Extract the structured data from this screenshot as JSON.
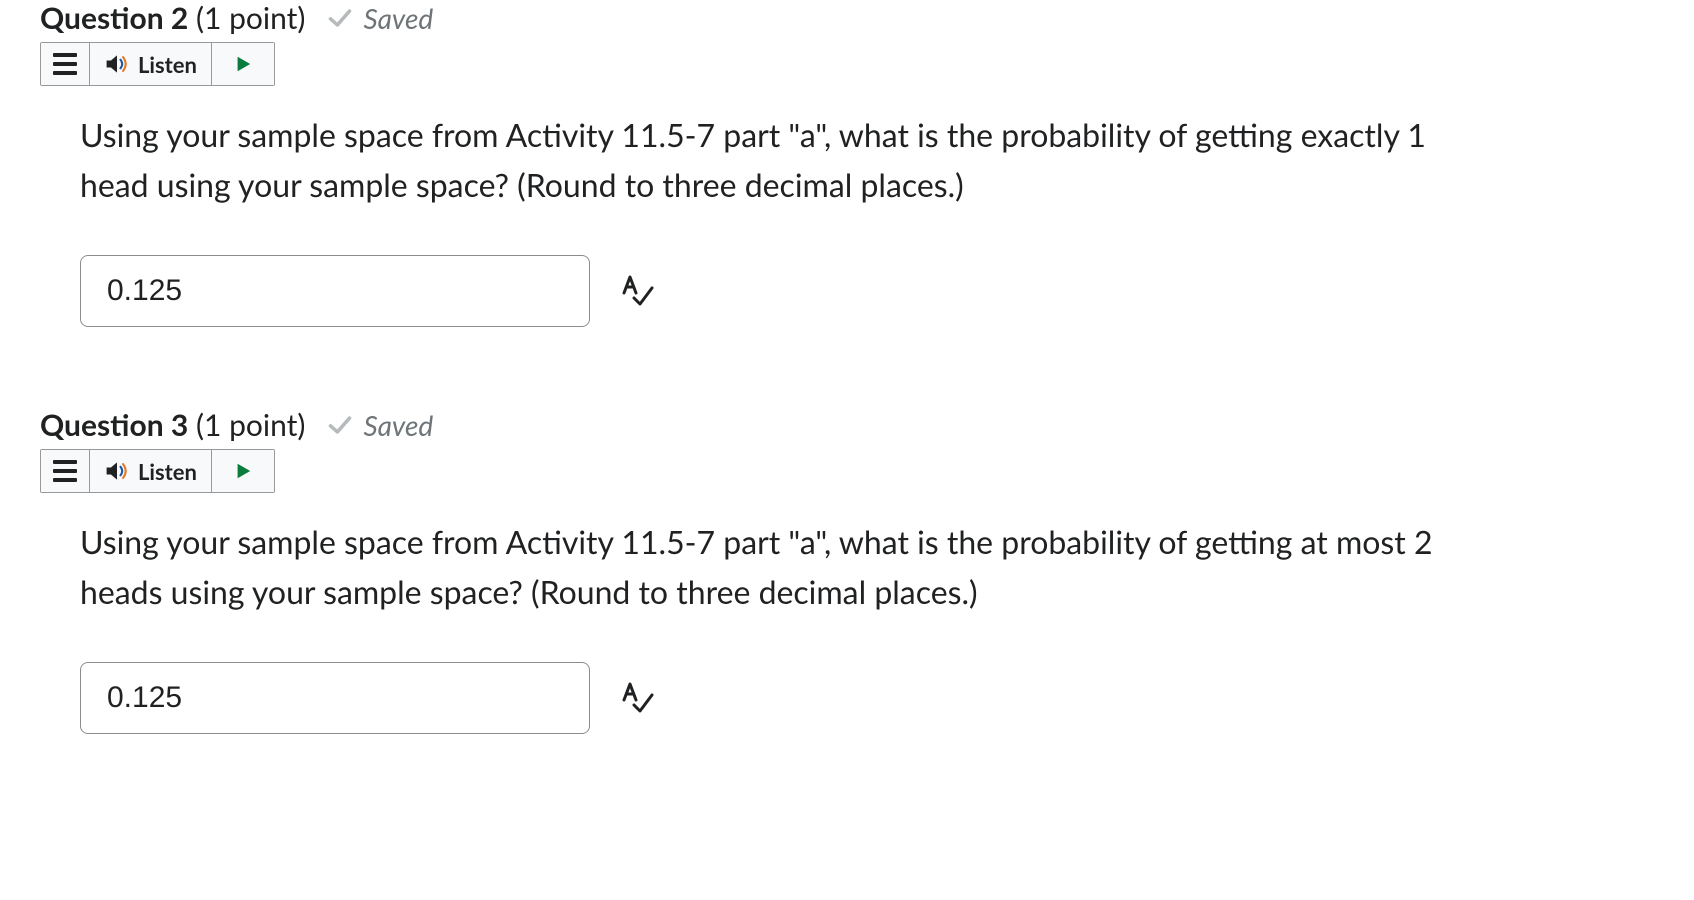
{
  "questions": [
    {
      "number": "Question 2",
      "points": "(1 point)",
      "savedLabel": "Saved",
      "listenLabel": "Listen",
      "text": "Using your sample space from Activity 11.5-7 part \"a\", what is the probability of getting exactly 1 head using your sample space? (Round to three decimal places.)",
      "answer": "0.125"
    },
    {
      "number": "Question 3",
      "points": "(1 point)",
      "savedLabel": "Saved",
      "listenLabel": "Listen",
      "text": "Using your sample space from Activity 11.5-7 part \"a\", what is the probability of getting at most 2 heads using your sample space? (Round to three decimal places.)",
      "answer": "0.125"
    }
  ]
}
